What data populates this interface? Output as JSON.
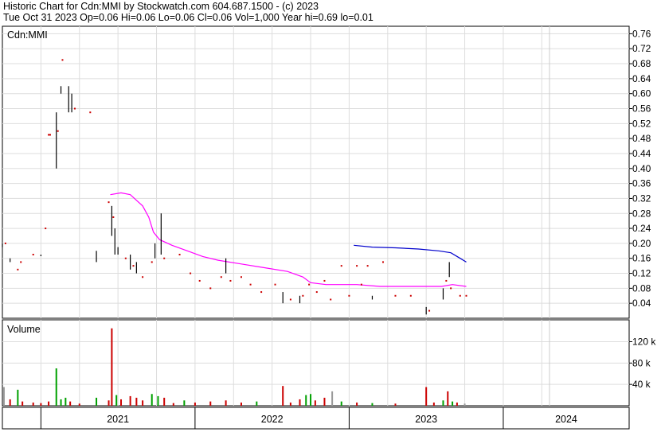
{
  "header": {
    "line1": "Historic Chart for Cdn:MMI by Stockwatch.com 604.687.1500 - (c) 2023",
    "line2": "Tue Oct 31 2023  Op=0.06  Hi=0.06  Lo=0.06  Cl=0.06  Vol=1,000  Year hi=0.69  lo=0.01"
  },
  "colors": {
    "price_bar": "#000000",
    "price_dot": "#cc0000",
    "ma_short": "#ff00ff",
    "ma_long": "#0000cc",
    "vol_up": "#00a000",
    "vol_down": "#cc0000",
    "vol_flat": "#999999",
    "grid": "#dddddd"
  },
  "chart_data": [
    {
      "type": "bar",
      "panel_label": "Cdn:MMI",
      "ylim": [
        0.0,
        0.78
      ],
      "yticks": [
        "0.76",
        "0.72",
        "0.68",
        "0.64",
        "0.60",
        "0.56",
        "0.52",
        "0.48",
        "0.44",
        "0.40",
        "0.36",
        "0.32",
        "0.28",
        "0.24",
        "0.20",
        "0.16",
        "0.12",
        "0.08",
        "0.04"
      ],
      "ytick_values": [
        0.76,
        0.72,
        0.68,
        0.64,
        0.6,
        0.56,
        0.52,
        0.48,
        0.44,
        0.4,
        0.36,
        0.32,
        0.28,
        0.24,
        0.2,
        0.16,
        0.12,
        0.08,
        0.04
      ],
      "x_range": [
        2020.75,
        2024.3
      ],
      "price_bars": [
        {
          "x": 2020.75,
          "low": 0.19,
          "high": 0.2
        },
        {
          "x": 2020.8,
          "low": 0.15,
          "high": 0.16
        },
        {
          "x": 2021.0,
          "low": 0.17,
          "high": 0.17
        },
        {
          "x": 2021.1,
          "low": 0.4,
          "high": 0.55
        },
        {
          "x": 2021.13,
          "low": 0.6,
          "high": 0.62
        },
        {
          "x": 2021.18,
          "low": 0.55,
          "high": 0.62
        },
        {
          "x": 2021.2,
          "low": 0.55,
          "high": 0.6
        },
        {
          "x": 2021.36,
          "low": 0.15,
          "high": 0.18
        },
        {
          "x": 2021.46,
          "low": 0.22,
          "high": 0.3
        },
        {
          "x": 2021.48,
          "low": 0.17,
          "high": 0.24
        },
        {
          "x": 2021.5,
          "low": 0.17,
          "high": 0.19
        },
        {
          "x": 2021.58,
          "low": 0.13,
          "high": 0.17
        },
        {
          "x": 2021.62,
          "low": 0.12,
          "high": 0.15
        },
        {
          "x": 2021.74,
          "low": 0.16,
          "high": 0.2
        },
        {
          "x": 2021.78,
          "low": 0.17,
          "high": 0.28
        },
        {
          "x": 2022.2,
          "low": 0.12,
          "high": 0.16
        },
        {
          "x": 2022.57,
          "low": 0.04,
          "high": 0.07
        },
        {
          "x": 2022.68,
          "low": 0.04,
          "high": 0.06
        },
        {
          "x": 2023.15,
          "low": 0.05,
          "high": 0.06
        },
        {
          "x": 2023.5,
          "low": 0.01,
          "high": 0.03
        },
        {
          "x": 2023.61,
          "low": 0.05,
          "high": 0.08
        },
        {
          "x": 2023.65,
          "low": 0.11,
          "high": 0.15
        }
      ],
      "price_dots": [
        {
          "x": 2020.77,
          "y": 0.2
        },
        {
          "x": 2020.85,
          "y": 0.13
        },
        {
          "x": 2020.87,
          "y": 0.15
        },
        {
          "x": 2020.95,
          "y": 0.17
        },
        {
          "x": 2021.03,
          "y": 0.24
        },
        {
          "x": 2021.05,
          "y": 0.49
        },
        {
          "x": 2021.06,
          "y": 0.49
        },
        {
          "x": 2021.11,
          "y": 0.5
        },
        {
          "x": 2021.14,
          "y": 0.69
        },
        {
          "x": 2021.22,
          "y": 0.56
        },
        {
          "x": 2021.32,
          "y": 0.55
        },
        {
          "x": 2021.44,
          "y": 0.31
        },
        {
          "x": 2021.47,
          "y": 0.27
        },
        {
          "x": 2021.55,
          "y": 0.16
        },
        {
          "x": 2021.6,
          "y": 0.14
        },
        {
          "x": 2021.66,
          "y": 0.11
        },
        {
          "x": 2021.72,
          "y": 0.15
        },
        {
          "x": 2021.8,
          "y": 0.16
        },
        {
          "x": 2021.9,
          "y": 0.17
        },
        {
          "x": 2021.97,
          "y": 0.12
        },
        {
          "x": 2022.03,
          "y": 0.1
        },
        {
          "x": 2022.1,
          "y": 0.08
        },
        {
          "x": 2022.17,
          "y": 0.11
        },
        {
          "x": 2022.23,
          "y": 0.1
        },
        {
          "x": 2022.3,
          "y": 0.11
        },
        {
          "x": 2022.36,
          "y": 0.09
        },
        {
          "x": 2022.43,
          "y": 0.07
        },
        {
          "x": 2022.52,
          "y": 0.09
        },
        {
          "x": 2022.62,
          "y": 0.05
        },
        {
          "x": 2022.7,
          "y": 0.06
        },
        {
          "x": 2022.74,
          "y": 0.09
        },
        {
          "x": 2022.79,
          "y": 0.07
        },
        {
          "x": 2022.84,
          "y": 0.1
        },
        {
          "x": 2022.88,
          "y": 0.05
        },
        {
          "x": 2022.95,
          "y": 0.14
        },
        {
          "x": 2023.0,
          "y": 0.06
        },
        {
          "x": 2023.05,
          "y": 0.14
        },
        {
          "x": 2023.08,
          "y": 0.09
        },
        {
          "x": 2023.12,
          "y": 0.14
        },
        {
          "x": 2023.22,
          "y": 0.15
        },
        {
          "x": 2023.3,
          "y": 0.06
        },
        {
          "x": 2023.4,
          "y": 0.06
        },
        {
          "x": 2023.52,
          "y": 0.02
        },
        {
          "x": 2023.63,
          "y": 0.1
        },
        {
          "x": 2023.66,
          "y": 0.08
        },
        {
          "x": 2023.72,
          "y": 0.06
        },
        {
          "x": 2023.76,
          "y": 0.06
        }
      ],
      "ma_short": [
        [
          2021.45,
          0.33
        ],
        [
          2021.52,
          0.335
        ],
        [
          2021.58,
          0.33
        ],
        [
          2021.66,
          0.3
        ],
        [
          2021.7,
          0.27
        ],
        [
          2021.73,
          0.23
        ],
        [
          2021.77,
          0.21
        ],
        [
          2021.85,
          0.195
        ],
        [
          2021.95,
          0.18
        ],
        [
          2022.05,
          0.165
        ],
        [
          2022.15,
          0.155
        ],
        [
          2022.3,
          0.145
        ],
        [
          2022.45,
          0.135
        ],
        [
          2022.6,
          0.125
        ],
        [
          2022.7,
          0.11
        ],
        [
          2022.75,
          0.095
        ],
        [
          2022.85,
          0.09
        ],
        [
          2022.95,
          0.09
        ],
        [
          2023.05,
          0.09
        ],
        [
          2023.2,
          0.085
        ],
        [
          2023.35,
          0.085
        ],
        [
          2023.5,
          0.085
        ],
        [
          2023.6,
          0.085
        ],
        [
          2023.67,
          0.09
        ],
        [
          2023.76,
          0.085
        ]
      ],
      "ma_long": [
        [
          2023.03,
          0.195
        ],
        [
          2023.15,
          0.19
        ],
        [
          2023.3,
          0.188
        ],
        [
          2023.45,
          0.185
        ],
        [
          2023.58,
          0.18
        ],
        [
          2023.66,
          0.175
        ],
        [
          2023.72,
          0.16
        ],
        [
          2023.76,
          0.15
        ]
      ]
    },
    {
      "type": "bar",
      "panel_label": "Volume",
      "ylim": [
        0,
        155000
      ],
      "yticks": [
        "120 k",
        "80 k",
        "40 k"
      ],
      "ytick_values": [
        120000,
        80000,
        40000
      ],
      "volume_bars": [
        {
          "x": 2020.76,
          "v": 35000,
          "dir": "flat"
        },
        {
          "x": 2020.8,
          "v": 12000,
          "dir": "down"
        },
        {
          "x": 2020.85,
          "v": 30000,
          "dir": "up"
        },
        {
          "x": 2020.88,
          "v": 8000,
          "dir": "down"
        },
        {
          "x": 2020.95,
          "v": 6000,
          "dir": "down"
        },
        {
          "x": 2021.0,
          "v": 5000,
          "dir": "down"
        },
        {
          "x": 2021.05,
          "v": 8000,
          "dir": "down"
        },
        {
          "x": 2021.1,
          "v": 70000,
          "dir": "up"
        },
        {
          "x": 2021.13,
          "v": 12000,
          "dir": "up"
        },
        {
          "x": 2021.16,
          "v": 15000,
          "dir": "up"
        },
        {
          "x": 2021.19,
          "v": 8000,
          "dir": "down"
        },
        {
          "x": 2021.25,
          "v": 4000,
          "dir": "down"
        },
        {
          "x": 2021.36,
          "v": 15000,
          "dir": "up"
        },
        {
          "x": 2021.44,
          "v": 10000,
          "dir": "down"
        },
        {
          "x": 2021.46,
          "v": 145000,
          "dir": "down"
        },
        {
          "x": 2021.49,
          "v": 20000,
          "dir": "up"
        },
        {
          "x": 2021.52,
          "v": 12000,
          "dir": "down"
        },
        {
          "x": 2021.58,
          "v": 18000,
          "dir": "down"
        },
        {
          "x": 2021.62,
          "v": 15000,
          "dir": "down"
        },
        {
          "x": 2021.66,
          "v": 10000,
          "dir": "down"
        },
        {
          "x": 2021.72,
          "v": 22000,
          "dir": "up"
        },
        {
          "x": 2021.76,
          "v": 18000,
          "dir": "up"
        },
        {
          "x": 2021.8,
          "v": 15000,
          "dir": "down"
        },
        {
          "x": 2021.86,
          "v": 5000,
          "dir": "down"
        },
        {
          "x": 2021.93,
          "v": 10000,
          "dir": "up"
        },
        {
          "x": 2022.0,
          "v": 6000,
          "dir": "down"
        },
        {
          "x": 2022.1,
          "v": 8000,
          "dir": "down"
        },
        {
          "x": 2022.2,
          "v": 10000,
          "dir": "down"
        },
        {
          "x": 2022.3,
          "v": 6000,
          "dir": "down"
        },
        {
          "x": 2022.4,
          "v": 8000,
          "dir": "up"
        },
        {
          "x": 2022.57,
          "v": 37000,
          "dir": "down"
        },
        {
          "x": 2022.62,
          "v": 6000,
          "dir": "down"
        },
        {
          "x": 2022.68,
          "v": 12000,
          "dir": "down"
        },
        {
          "x": 2022.72,
          "v": 20000,
          "dir": "up"
        },
        {
          "x": 2022.75,
          "v": 22000,
          "dir": "up"
        },
        {
          "x": 2022.78,
          "v": 10000,
          "dir": "down"
        },
        {
          "x": 2022.84,
          "v": 15000,
          "dir": "down"
        },
        {
          "x": 2022.89,
          "v": 27000,
          "dir": "flat"
        },
        {
          "x": 2022.95,
          "v": 8000,
          "dir": "up"
        },
        {
          "x": 2023.05,
          "v": 6000,
          "dir": "down"
        },
        {
          "x": 2023.15,
          "v": 5000,
          "dir": "up"
        },
        {
          "x": 2023.3,
          "v": 4000,
          "dir": "down"
        },
        {
          "x": 2023.5,
          "v": 35000,
          "dir": "down"
        },
        {
          "x": 2023.55,
          "v": 6000,
          "dir": "down"
        },
        {
          "x": 2023.61,
          "v": 10000,
          "dir": "up"
        },
        {
          "x": 2023.64,
          "v": 27000,
          "dir": "down"
        },
        {
          "x": 2023.67,
          "v": 8000,
          "dir": "up"
        },
        {
          "x": 2023.7,
          "v": 6000,
          "dir": "down"
        },
        {
          "x": 2023.75,
          "v": 4000,
          "dir": "flat"
        }
      ]
    }
  ],
  "x_axis": {
    "years": [
      {
        "label": "2021",
        "start": 2021.0
      },
      {
        "label": "2022",
        "start": 2022.0
      },
      {
        "label": "2023",
        "start": 2023.0
      },
      {
        "label": "2024",
        "start": 2024.0
      }
    ],
    "month_grid": [
      2021.0,
      2021.25,
      2021.5,
      2021.75,
      2022.0,
      2022.25,
      2022.5,
      2022.75,
      2023.0,
      2023.25,
      2023.5,
      2023.75,
      2024.0,
      2024.25
    ]
  }
}
